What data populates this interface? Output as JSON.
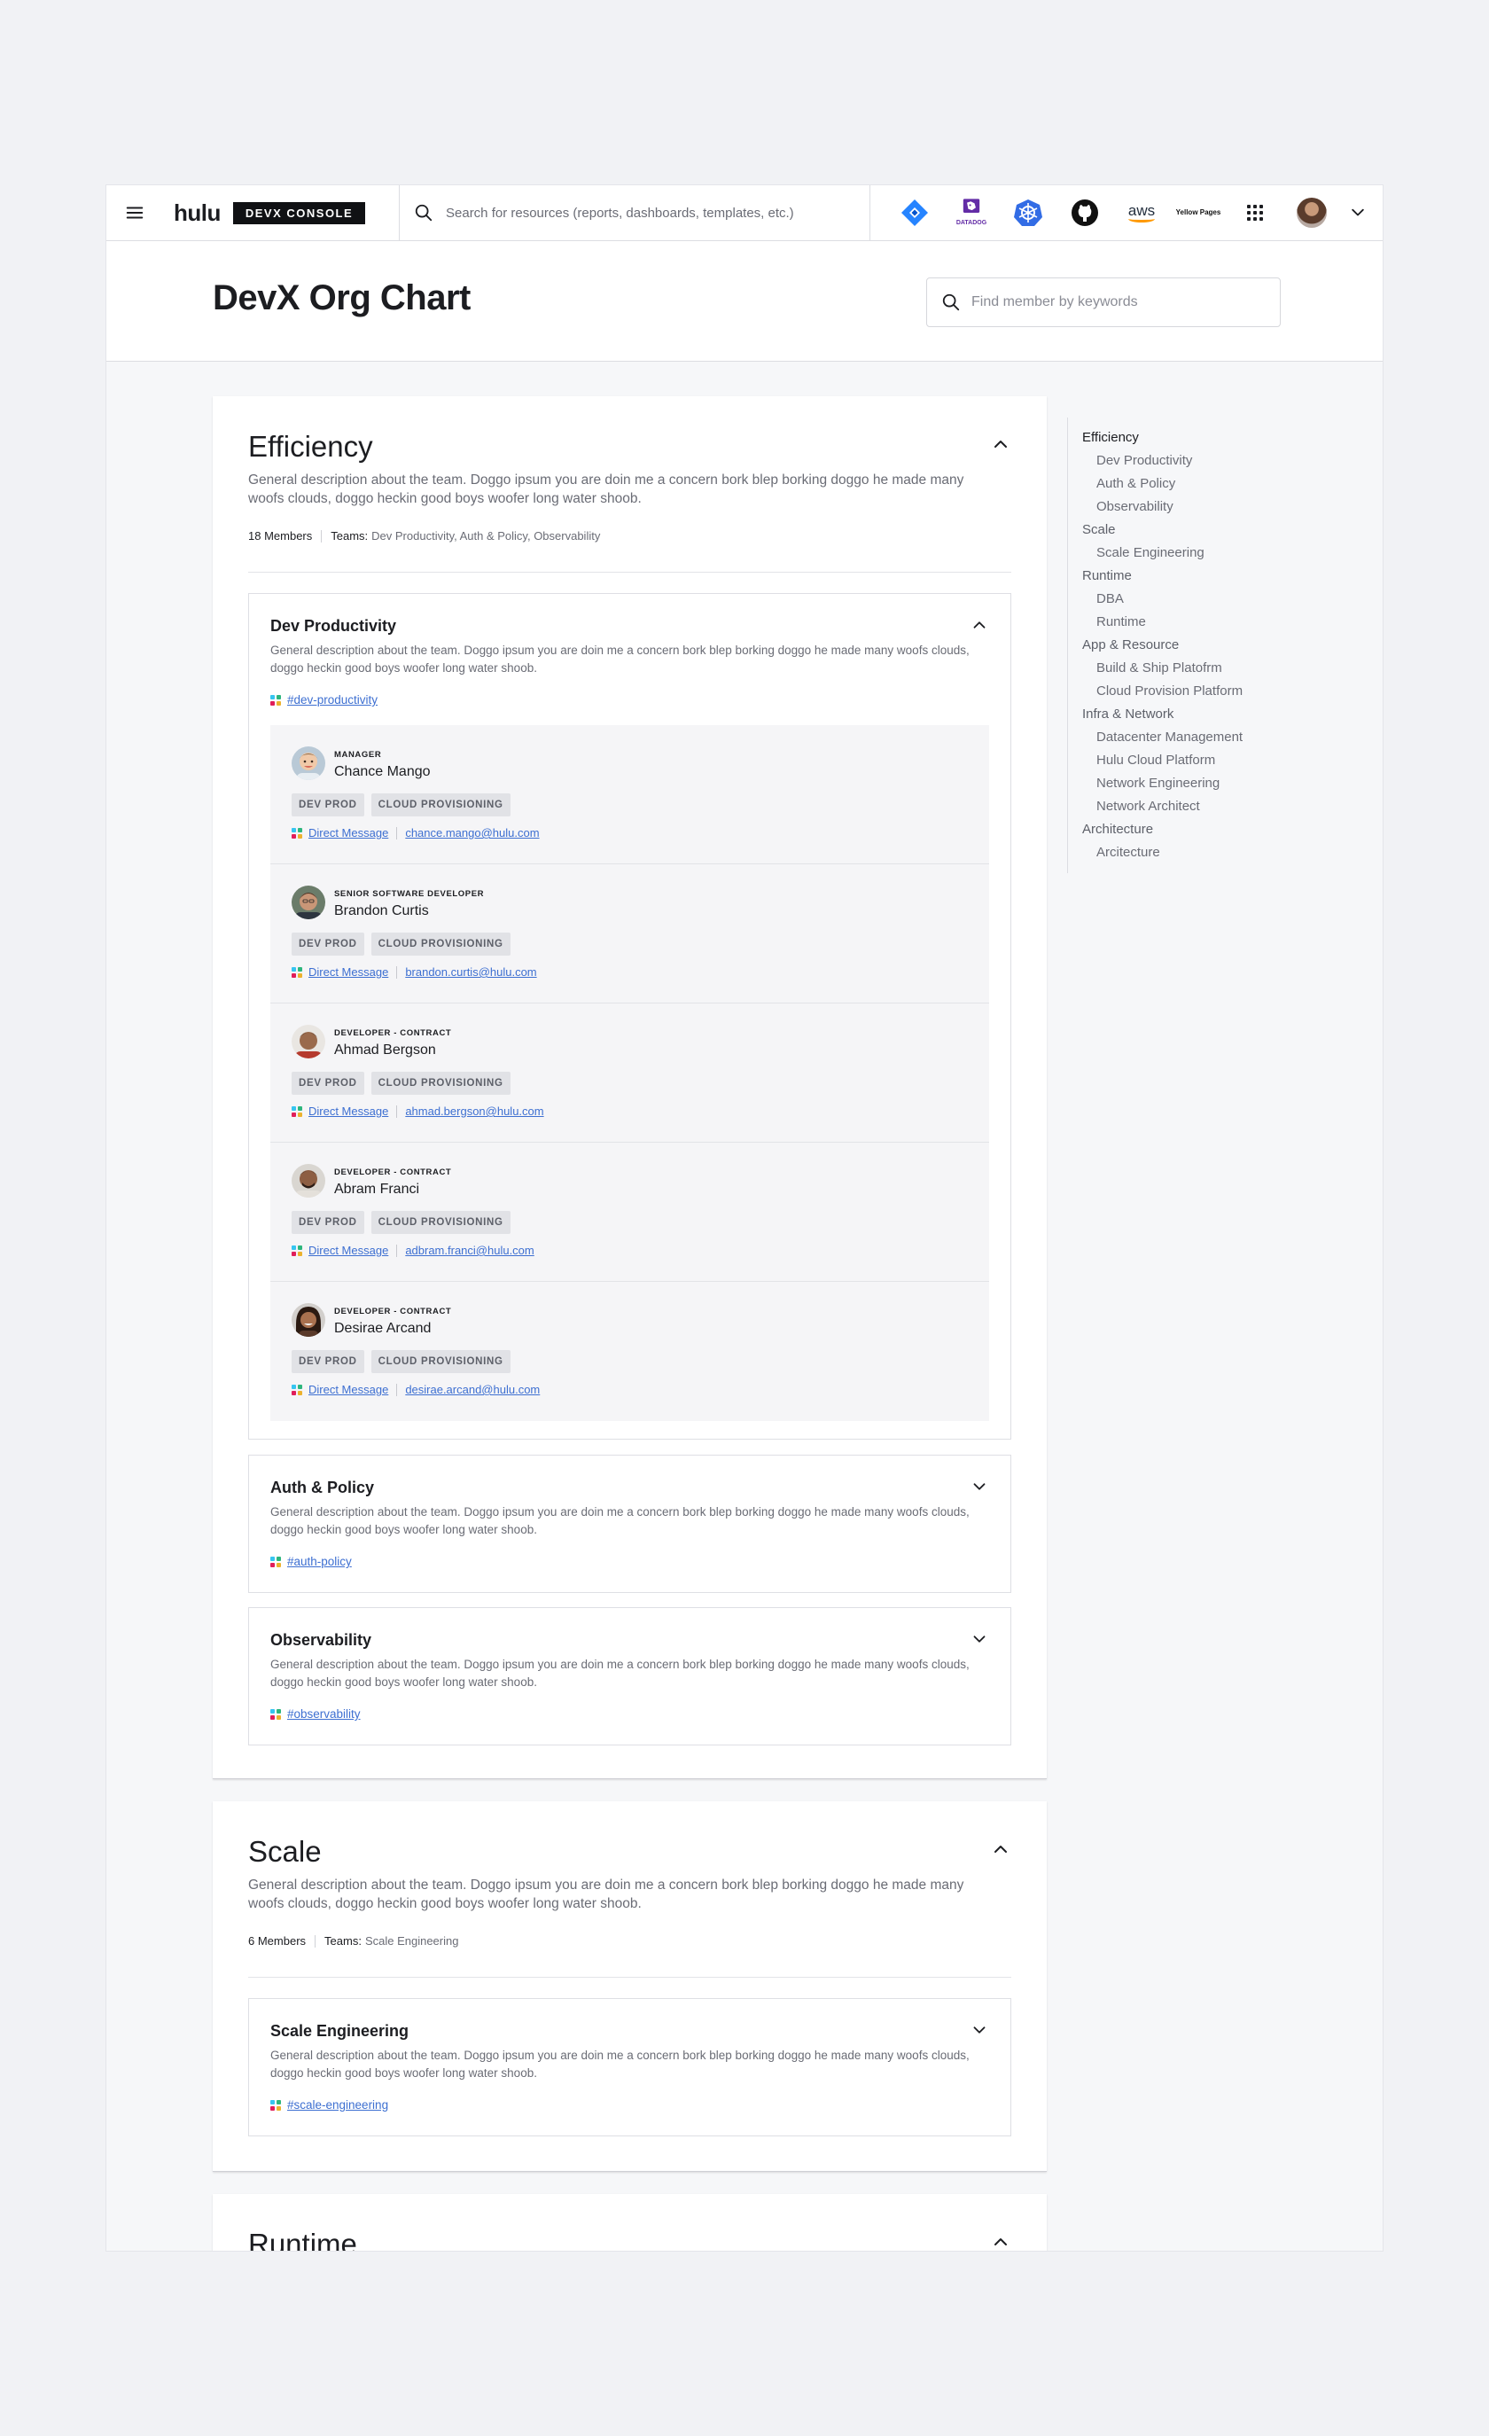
{
  "nav": {
    "logo": "hulu",
    "console_badge": "DEVX CONSOLE",
    "search_placeholder": "Search for resources (reports, dashboards, templates, etc.)",
    "datadog_label": "DATADOG",
    "aws_label": "aws",
    "yellow_pages_label": "Yellow Pages"
  },
  "header": {
    "title": "DevX Org Chart",
    "member_search_placeholder": "Find member by keywords"
  },
  "sections": [
    {
      "title": "Efficiency",
      "description": "General description about the team. Doggo ipsum you are doin me a concern bork blep borking doggo he made many woofs clouds, doggo heckin good boys woofer long water shoob.",
      "members_label": "18 Members",
      "teams_label": "Teams:",
      "teams_value": "Dev Productivity, Auth & Policy, Observability",
      "teams": [
        {
          "title": "Dev Productivity",
          "description": "General description about the team. Doggo ipsum you are doin me a concern bork blep borking doggo he made many woofs clouds, doggo heckin good boys woofer long water shoob.",
          "channel": "#dev-productivity",
          "members": [
            {
              "role": "MANAGER",
              "name": "Chance Mango",
              "tags": [
                "DEV PROD",
                "CLOUD PROVISIONING"
              ],
              "dm": "Direct Message",
              "email": "chance.mango@hulu.com"
            },
            {
              "role": "SENIOR SOFTWARE DEVELOPER",
              "name": "Brandon Curtis",
              "tags": [
                "DEV PROD",
                "CLOUD PROVISIONING"
              ],
              "dm": "Direct Message",
              "email": "brandon.curtis@hulu.com"
            },
            {
              "role": "DEVELOPER - CONTRACT",
              "name": "Ahmad Bergson",
              "tags": [
                "DEV PROD",
                "CLOUD PROVISIONING"
              ],
              "dm": "Direct Message",
              "email": "ahmad.bergson@hulu.com"
            },
            {
              "role": "DEVELOPER - CONTRACT",
              "name": "Abram Franci",
              "tags": [
                "DEV PROD",
                "CLOUD PROVISIONING"
              ],
              "dm": "Direct Message",
              "email": "adbram.franci@hulu.com"
            },
            {
              "role": "DEVELOPER - CONTRACT",
              "name": "Desirae Arcand",
              "tags": [
                "DEV PROD",
                "CLOUD PROVISIONING"
              ],
              "dm": "Direct Message",
              "email": "desirae.arcand@hulu.com"
            }
          ]
        },
        {
          "title": "Auth & Policy",
          "description": "General description about the team. Doggo ipsum you are doin me a concern bork blep borking doggo he made many woofs clouds, doggo heckin good boys woofer long water shoob.",
          "channel": "#auth-policy"
        },
        {
          "title": "Observability",
          "description": "General description about the team. Doggo ipsum you are doin me a concern bork blep borking doggo he made many woofs clouds, doggo heckin good boys woofer long water shoob.",
          "channel": "#observability"
        }
      ]
    },
    {
      "title": "Scale",
      "description": "General description about the team. Doggo ipsum you are doin me a concern bork blep borking doggo he made many woofs clouds, doggo heckin good boys woofer long water shoob.",
      "members_label": "6 Members",
      "teams_label": "Teams:",
      "teams_value": "Scale Engineering",
      "teams": [
        {
          "title": "Scale Engineering",
          "description": "General description about the team. Doggo ipsum you are doin me a concern bork blep borking doggo he made many woofs clouds, doggo heckin good boys woofer long water shoob.",
          "channel": "#scale-engineering"
        }
      ]
    },
    {
      "title": "Runtime"
    }
  ],
  "toc": [
    {
      "label": "Efficiency",
      "level": 1,
      "active": true
    },
    {
      "label": "Dev Productivity",
      "level": 2
    },
    {
      "label": "Auth & Policy",
      "level": 2
    },
    {
      "label": "Observability",
      "level": 2
    },
    {
      "label": "Scale",
      "level": 1
    },
    {
      "label": "Scale Engineering",
      "level": 2
    },
    {
      "label": "Runtime",
      "level": 1
    },
    {
      "label": "DBA",
      "level": 2
    },
    {
      "label": "Runtime",
      "level": 2
    },
    {
      "label": "App & Resource",
      "level": 1
    },
    {
      "label": "Build & Ship Platofrm",
      "level": 2
    },
    {
      "label": "Cloud Provision Platform",
      "level": 2
    },
    {
      "label": "Infra & Network",
      "level": 1
    },
    {
      "label": "Datacenter Management",
      "level": 2
    },
    {
      "label": "Hulu Cloud Platform",
      "level": 2
    },
    {
      "label": "Network Engineering",
      "level": 2
    },
    {
      "label": "Network Architect",
      "level": 2
    },
    {
      "label": "Architecture",
      "level": 1
    },
    {
      "label": "Arcitecture",
      "level": 2
    }
  ]
}
